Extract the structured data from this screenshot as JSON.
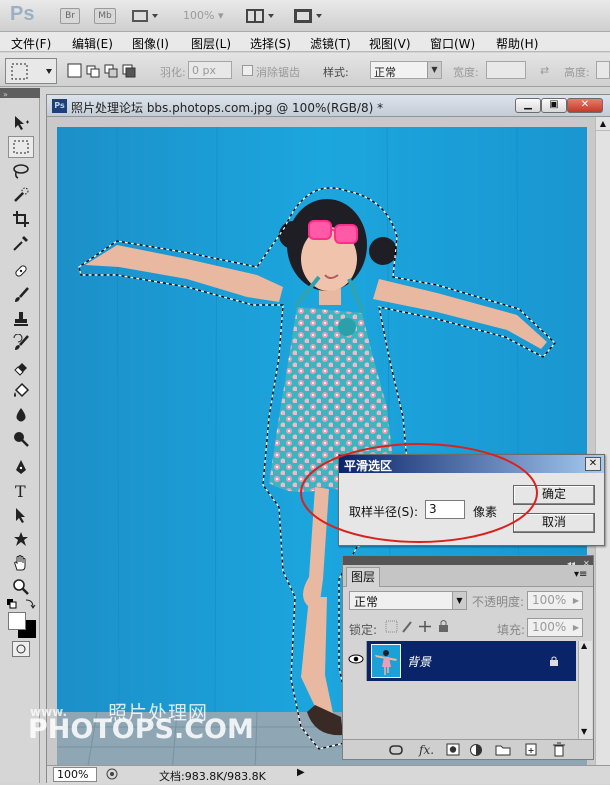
{
  "app": {
    "logo": "Ps",
    "bridge_label": "Br",
    "minibridge_label": "Mb",
    "zoom_level": "100%"
  },
  "menubar": [
    {
      "label": "文件(F)"
    },
    {
      "label": "编辑(E)"
    },
    {
      "label": "图像(I)"
    },
    {
      "label": "图层(L)"
    },
    {
      "label": "选择(S)"
    },
    {
      "label": "滤镜(T)"
    },
    {
      "label": "视图(V)"
    },
    {
      "label": "窗口(W)"
    },
    {
      "label": "帮助(H)"
    }
  ],
  "options_bar": {
    "feather_label": "羽化:",
    "feather_value": "0 px",
    "antialias_label": "消除锯齿",
    "style_label": "样式:",
    "style_value": "正常",
    "width_label": "宽度:",
    "height_label": "高度:"
  },
  "document": {
    "title": "照片处理论坛 bbs.photops.com.jpg @ 100%(RGB/8) *",
    "status_zoom": "100%",
    "status_doc": "文档:983.8K/983.8K"
  },
  "dialog": {
    "title": "平滑选区",
    "radius_label": "取样半径(S):",
    "radius_value": "3",
    "unit": "像素",
    "ok_label": "确定",
    "cancel_label": "取消"
  },
  "layers_panel": {
    "tab_label": "图层",
    "blend_mode": "正常",
    "opacity_label": "不透明度:",
    "opacity_value": "100%",
    "lock_label": "锁定:",
    "fill_label": "填充:",
    "fill_value": "100%",
    "layers": [
      {
        "name": "背景",
        "visible": true,
        "selected": true
      }
    ]
  },
  "watermark": {
    "small": "www.",
    "chinese": "照片处理网",
    "url": "PHOTOPS.COM"
  },
  "colors": {
    "canvas_blue": "#1ba1d8",
    "dialog_title_start": "#0a246a",
    "dialog_title_end": "#a6caf0",
    "highlight_ellipse": "#d9221c",
    "layer_selected": "#0a246a"
  }
}
